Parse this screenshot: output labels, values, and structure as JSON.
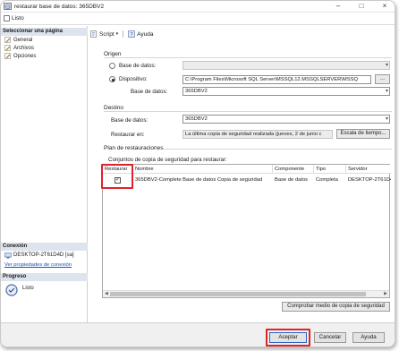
{
  "window": {
    "title": "restaurar base de datos: 365DBV2"
  },
  "status_line": {
    "label": "Listo"
  },
  "sidebar": {
    "pages_header": "Seleccionar una página",
    "pages": [
      {
        "label": "General"
      },
      {
        "label": "Archivos"
      },
      {
        "label": "Opciones"
      }
    ],
    "connection_header": "Conexión",
    "connection_server": "DESKTOP-2T61D4D [sa]",
    "connection_link": "Ver propiedades de conexión",
    "progress_header": "Progreso",
    "progress_status": "Listo"
  },
  "toolbar": {
    "script_label": "Script",
    "help_label": "Ayuda"
  },
  "origen": {
    "title": "Origen",
    "db_radio_label": "Base de datos:",
    "device_radio_label": "Dispositivo:",
    "device_path": "C:\\Program Files\\Microsoft SQL Server\\MSSQL12.MSSQLSERVER\\MSSQ",
    "browse_label": "...",
    "db_label": "Base de datos:",
    "db_value": "365DBV2"
  },
  "destino": {
    "title": "Destino",
    "db_label": "Base de datos:",
    "db_value": "365DBV2",
    "restore_to_label": "Restaurar en:",
    "restore_to_value": "La última copia de seguridad realizada (jueves, 2 de junio c",
    "timeline_label": "Escala de tiempo..."
  },
  "plan": {
    "title": "Plan de restauraciones",
    "sets_label": "Conjuntos de copia de seguridad para restaurar:",
    "columns": [
      "Restaurar",
      "Nombre",
      "Componente",
      "Tipo",
      "Servidor"
    ],
    "rows": [
      {
        "restore": true,
        "name": "365DBV2-Complete Base de datos Copia de seguridad",
        "component": "Base de datos",
        "type": "Completa",
        "server": "DESKTOP-2T61D4"
      }
    ],
    "verify_label": "Comprobar medio de copia de seguridad"
  },
  "footer": {
    "ok_label": "Aceptar",
    "cancel_label": "Cancelar",
    "help_label": "Ayuda"
  },
  "colors": {
    "highlight": "#e0232b",
    "sidebar_header": "#dde4ee",
    "link": "#1a55b8"
  }
}
